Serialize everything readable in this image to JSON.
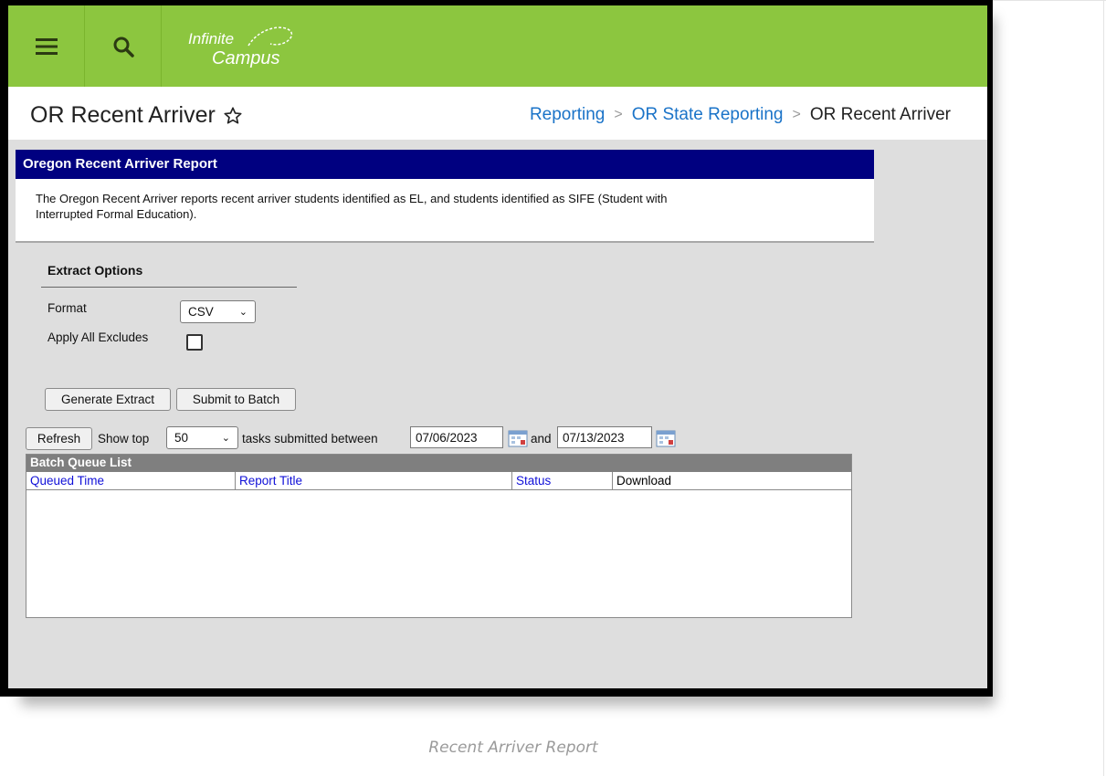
{
  "app": {
    "logo_line1": "Infinite",
    "logo_line2": "Campus"
  },
  "header": {
    "title": "OR Recent Arriver",
    "breadcrumb": [
      "Reporting",
      "OR State Reporting",
      "OR Recent Arriver"
    ]
  },
  "report": {
    "title": "Oregon Recent Arriver Report",
    "description_line1": "The Oregon Recent Arriver reports recent arriver students identified as EL, and students identified as SIFE (Student with",
    "description_line2": "Interrupted Formal Education)."
  },
  "extract_options": {
    "title": "Extract Options",
    "format_label": "Format",
    "format_value": "CSV",
    "excludes_label": "Apply All Excludes",
    "excludes_checked": false
  },
  "actions": {
    "generate": "Generate Extract",
    "submit": "Submit to Batch"
  },
  "batch_filter": {
    "refresh": "Refresh",
    "show_top": "Show top",
    "count": "50",
    "between": "tasks submitted between",
    "start_date": "07/06/2023",
    "and": "and",
    "end_date": "07/13/2023"
  },
  "batch_queue": {
    "title": "Batch Queue List",
    "columns": [
      "Queued Time",
      "Report Title",
      "Status",
      "Download"
    ],
    "rows": []
  },
  "caption": "Recent Arriver Report",
  "colors": {
    "topbar": "#8cc63f",
    "panel_header": "#000080",
    "link": "#1a73c8"
  }
}
